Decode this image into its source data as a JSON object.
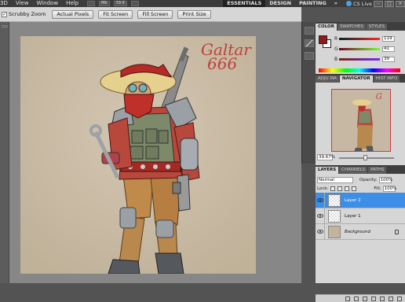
{
  "menubar": {
    "items": [
      "3D",
      "View",
      "Window",
      "Help"
    ],
    "tool_chips": [
      "",
      "Mb",
      "39.9",
      ""
    ],
    "workspaces": [
      "ESSENTIALS",
      "DESIGN",
      "PAINTING",
      "»"
    ],
    "cs_live": "CS Live"
  },
  "options": {
    "scrubby_zoom_label": "Scrubby Zoom",
    "buttons": [
      "Actual Pixels",
      "Fit Screen",
      "Fill Screen",
      "Print Size"
    ]
  },
  "artwork": {
    "signature_line1": "Galtar",
    "signature_line2": "666"
  },
  "color_panel": {
    "tabs": [
      "COLOR",
      "SWATCHES",
      "STYLES"
    ],
    "channels": [
      {
        "label": "R",
        "value": "119"
      },
      {
        "label": "G",
        "value": "41"
      },
      {
        "label": "B",
        "value": "39"
      }
    ],
    "foreground_color": "#772927",
    "background_color": "#ffffff"
  },
  "navigator_panel": {
    "tabs": [
      "ADJUSTMENTS",
      "NAVIGATOR",
      "HISTOGRAM"
    ],
    "tab_labels_shown": [
      "ADJU MA",
      "NAVIGATOR",
      "HIST INFO"
    ],
    "zoom": "39.67%"
  },
  "layers_panel": {
    "tabs": [
      "LAYERS",
      "CHANNELS",
      "PATHS"
    ],
    "blend_mode": "Normal",
    "opacity_label": "Opacity:",
    "opacity": "100%",
    "lock_label": "Lock:",
    "fill_label": "Fill:",
    "fill": "100%",
    "layers": [
      {
        "name": "Layer 2",
        "selected": true
      },
      {
        "name": "Layer 1",
        "selected": false
      },
      {
        "name": "Background",
        "selected": false
      }
    ]
  }
}
